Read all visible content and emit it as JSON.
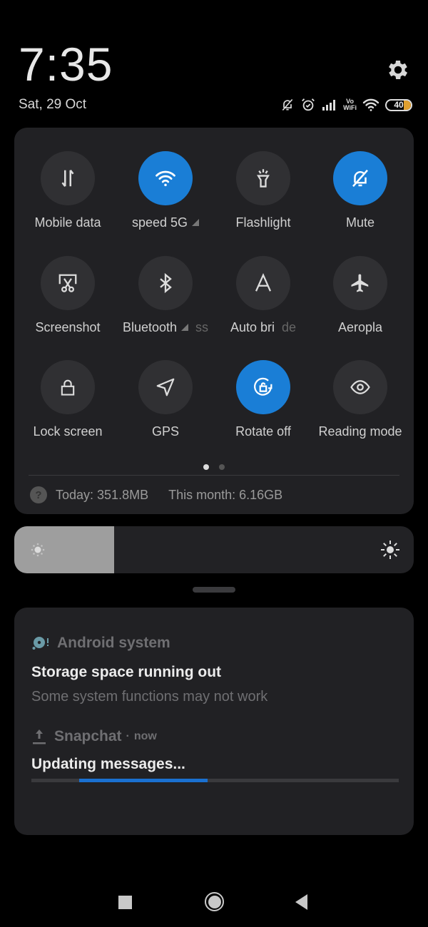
{
  "status": {
    "time": "7:35",
    "date": "Sat, 29 Oct",
    "battery_level": "40",
    "vowifi_top": "Vo",
    "vowifi_bottom": "WiFi",
    "icons": [
      "bell-off-icon",
      "alarm-icon",
      "signal-icon",
      "vowifi-icon",
      "wifi-icon",
      "battery-icon"
    ]
  },
  "quick_settings": {
    "tiles": [
      {
        "label": "Mobile data",
        "icon": "mobile-data-icon",
        "active": false
      },
      {
        "label": "speed 5G",
        "icon": "wifi-icon",
        "active": true,
        "has_arrow": true
      },
      {
        "label": "Flashlight",
        "icon": "flashlight-icon",
        "active": false
      },
      {
        "label": "Mute",
        "icon": "bell-off-icon",
        "active": true
      },
      {
        "label": "Screenshot",
        "icon": "screenshot-icon",
        "active": false
      },
      {
        "label": "Bluetooth",
        "label_suffix": "ss",
        "icon": "bluetooth-icon",
        "active": false,
        "has_arrow": true
      },
      {
        "label": "Auto bri",
        "label_suffix": "de",
        "icon": "auto-brightness-icon",
        "active": false
      },
      {
        "label": "Aeropla",
        "icon": "airplane-icon",
        "active": false
      },
      {
        "label": "Lock screen",
        "icon": "lock-icon",
        "active": false
      },
      {
        "label": "GPS",
        "icon": "location-icon",
        "active": false
      },
      {
        "label": "Rotate off",
        "icon": "rotation-lock-icon",
        "active": true
      },
      {
        "label": "Reading mode",
        "icon": "eye-icon",
        "active": false
      }
    ],
    "page_count": 2,
    "current_page": 1,
    "usage_today": "Today: 351.8MB",
    "usage_month": "This month: 6.16GB",
    "help_glyph": "?"
  },
  "brightness": {
    "level": 0.25
  },
  "notifications": [
    {
      "app": "Android system",
      "icon": "storage-icon",
      "title": "Storage space running out",
      "body": "Some system functions may not work"
    },
    {
      "app": "Snapchat",
      "icon": "upload-icon",
      "time": "now",
      "separator": "·",
      "title": "Updating messages...",
      "progress_start": 0.13,
      "progress_end": 0.48
    }
  ],
  "colors": {
    "accent": "#1a7ed6",
    "panel": "#212124",
    "tile_off": "#303033",
    "battery": "#e0a030"
  },
  "navbar": {
    "buttons": [
      "recents",
      "home",
      "back"
    ]
  }
}
